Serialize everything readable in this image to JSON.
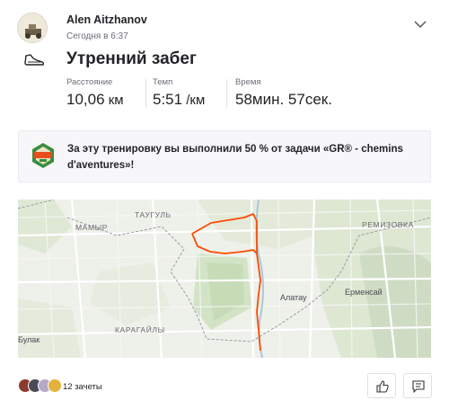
{
  "post": {
    "author": "Alen Aitzhanov",
    "timestamp": "Сегодня в 6:37",
    "title": "Утренний забег",
    "activity_icon": "running-shoe-icon"
  },
  "stats": [
    {
      "label": "Расстояние",
      "value": "10,06",
      "unit": " км"
    },
    {
      "label": "Темп",
      "value": "5:51",
      "unit": " /км"
    },
    {
      "label": "Время",
      "value": "58мин. 57сек.",
      "unit": ""
    }
  ],
  "achievement": {
    "text": "За эту тренировку вы выполнили 50 % от задачи «GR® - chemins d'aventures»!",
    "icon": "challenge-badge-icon"
  },
  "map": {
    "labels": [
      "МАМЫР",
      "ТАУГУЛЬ",
      "РЕМИЗОВКА",
      "Алатау",
      "Ерменсай",
      "КАРАГАЙЛЫ",
      "Булак"
    ],
    "route_color": "#fc4c02"
  },
  "kudos": {
    "count_label": "12 зачеты"
  },
  "colors": {
    "accent": "#fc4c02",
    "text": "#242428",
    "muted": "#6d6d78"
  }
}
